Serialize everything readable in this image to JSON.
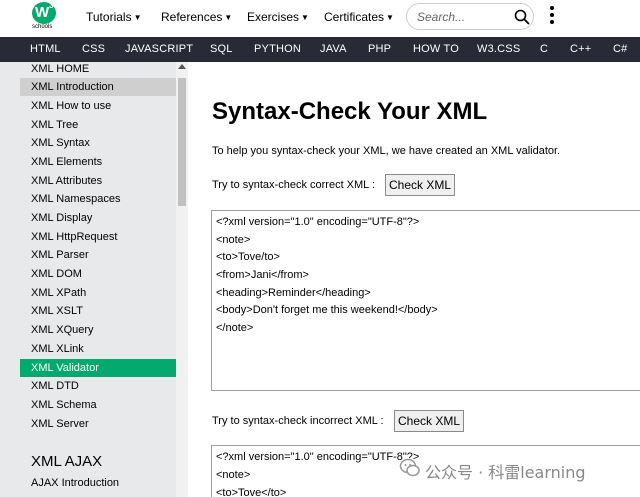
{
  "logo": {
    "letter": "W",
    "superscript": "3",
    "text": "schools"
  },
  "topnav": [
    {
      "label": "Tutorials"
    },
    {
      "label": "References"
    },
    {
      "label": "Exercises"
    },
    {
      "label": "Certificates"
    }
  ],
  "search": {
    "placeholder": "Search..."
  },
  "darknav": [
    "HTML",
    "CSS",
    "JAVASCRIPT",
    "SQL",
    "PYTHON",
    "JAVA",
    "PHP",
    "HOW TO",
    "W3.CSS",
    "C",
    "C++",
    "C#"
  ],
  "sidebar": {
    "items": [
      "XML HOME",
      "XML Introduction",
      "XML How to use",
      "XML Tree",
      "XML Syntax",
      "XML Elements",
      "XML Attributes",
      "XML Namespaces",
      "XML Display",
      "XML HttpRequest",
      "XML Parser",
      "XML DOM",
      "XML XPath",
      "XML XSLT",
      "XML XQuery",
      "XML XLink",
      "XML Validator",
      "XML DTD",
      "XML Schema",
      "XML Server"
    ],
    "highlighted": "XML Introduction",
    "active": "XML Validator",
    "section_heading": "XML AJAX",
    "section_items": [
      "AJAX Introduction"
    ]
  },
  "main": {
    "title": "Syntax-Check Your XML",
    "intro": "To help you syntax-check your XML, we have created an XML validator.",
    "correct_prompt": "Try to syntax-check correct XML :",
    "incorrect_prompt": "Try to syntax-check incorrect XML :",
    "check_button": "Check XML",
    "correct_code": [
      "<?xml version=\"1.0\" encoding=\"UTF-8\"?>",
      "<note>",
      "<to>Tove/to>",
      "<from>Jani</from>",
      "<heading>Reminder</heading>",
      "<body>Don't forget me this weekend!</body>",
      "</note>"
    ],
    "incorrect_code": [
      "<?xml version=\"1.0\" encoding=\"UTF-8\"?>",
      "<note>",
      "<to>Tove</to>"
    ]
  },
  "watermark": {
    "text": "公众号 · 科雷learning"
  },
  "colors": {
    "accent": "#04AA6D",
    "darknav": "#282A35",
    "sidebar": "#E7E9EB"
  },
  "icons": {
    "search": "search-icon",
    "menu": "kebab-menu-icon",
    "scroll": "scroll-up-icon",
    "watermark": "wechat-icon"
  }
}
